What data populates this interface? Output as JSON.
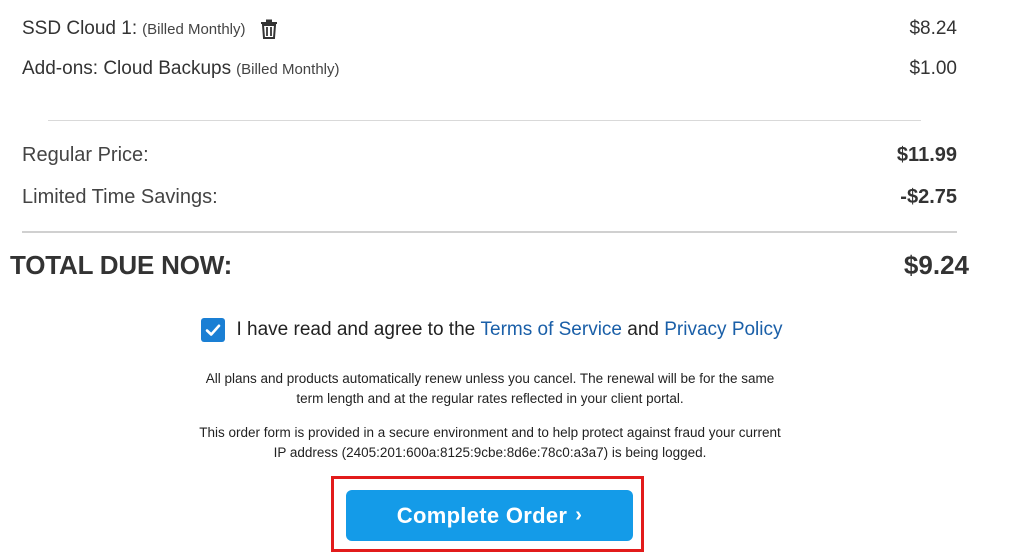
{
  "cart": {
    "items": [
      {
        "name": "SSD Cloud 1:",
        "note": "(Billed Monthly)",
        "price": "$8.24",
        "icon": "trash-icon"
      },
      {
        "name": "Add-ons: Cloud Backups",
        "note": "(Billed Monthly)",
        "price": "$1.00"
      }
    ]
  },
  "summary": {
    "regular_label": "Regular Price:",
    "regular_value": "$11.99",
    "savings_label": "Limited Time Savings:",
    "savings_value": "-$2.75",
    "total_label": "TOTAL DUE NOW:",
    "total_value": "$9.24"
  },
  "agreement": {
    "checked": true,
    "prefix": "I have read and agree to the",
    "terms_link": "Terms of Service",
    "and": "and",
    "privacy_link": "Privacy Policy"
  },
  "notices": {
    "renewal_line1": "All plans and products automatically renew unless you cancel. The renewal will be for the same",
    "renewal_line2": "term length and at the regular rates reflected in your client portal.",
    "security_line1": "This order form is provided in a secure environment and to help protect against fraud your current",
    "security_line2": "IP address (2405:201:600a:8125:9cbe:8d6e:78c0:a3a7) is being logged."
  },
  "submit": {
    "label": "Complete Order",
    "chevron": "›"
  },
  "colors": {
    "accent_button": "#149be8",
    "link": "#1a5fa8",
    "checkbox": "#1a7fd4",
    "highlight_frame": "#e21b1b"
  }
}
